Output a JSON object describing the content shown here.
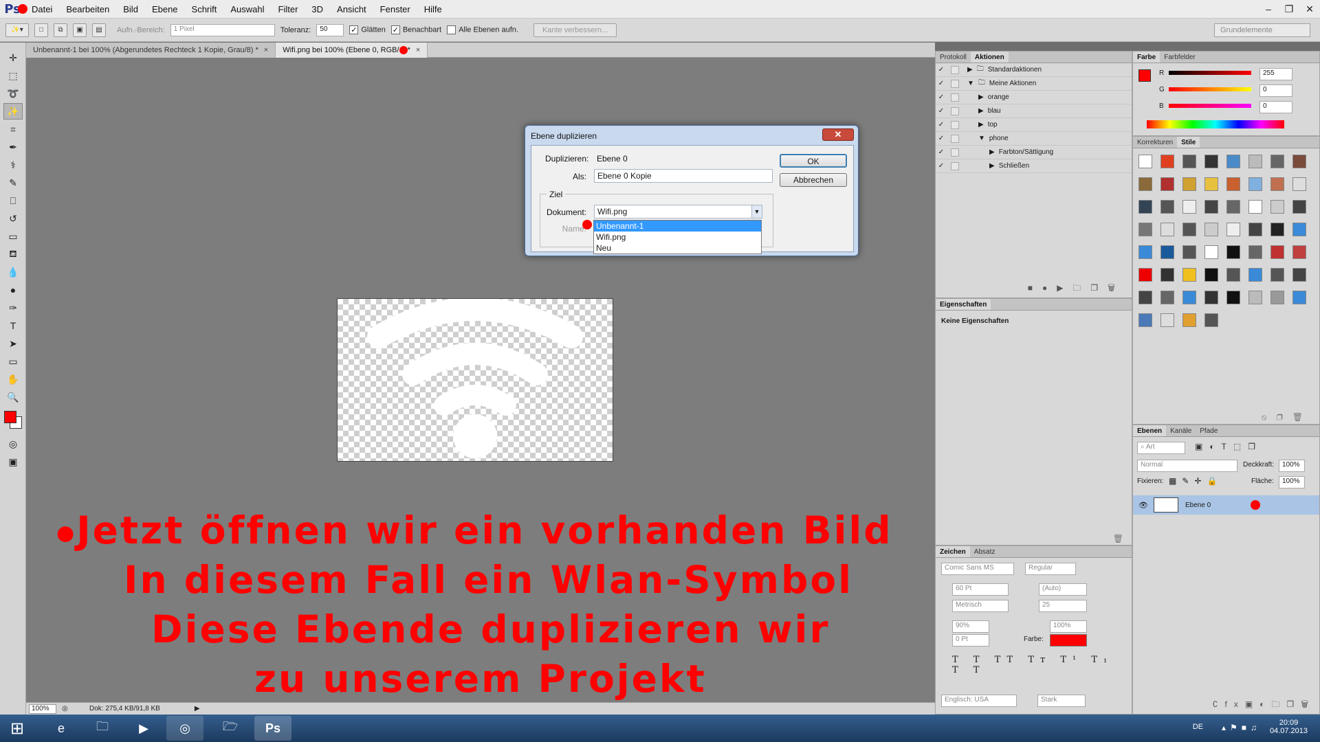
{
  "menubar": {
    "logo": "Ps",
    "items": [
      "Datei",
      "Bearbeiten",
      "Bild",
      "Ebene",
      "Schrift",
      "Auswahl",
      "Filter",
      "3D",
      "Ansicht",
      "Fenster",
      "Hilfe"
    ]
  },
  "options": {
    "aufn_label": "Aufn.-Bereich:",
    "aufn_value": "1 Pixel",
    "toleranz_label": "Toleranz:",
    "toleranz_value": "50",
    "glaetten": "Glätten",
    "benachbart": "Benachbart",
    "alle_ebenen": "Alle Ebenen aufn.",
    "kante": "Kante verbessern...",
    "workspace": "Grundelemente"
  },
  "tabs": [
    {
      "label": "Unbenannt-1 bei 100% (Abgerundetes Rechteck 1 Kopie, Grau/8) *"
    },
    {
      "label": "Wifi.png bei 100% (Ebene 0, RGB/"
    }
  ],
  "status": {
    "zoom": "100%",
    "doc": "Dok: 275,4 KB/91,8 KB"
  },
  "caption": {
    "line1": "Jetzt öffnen wir ein vorhanden Bild",
    "line2": "In diesem Fall ein Wlan-Symbol",
    "line3": "Diese Ebende duplizieren wir",
    "line4": "zu unserem Projekt"
  },
  "dialog": {
    "title": "Ebene duplizieren",
    "dup_label": "Duplizieren:",
    "dup_value": "Ebene 0",
    "als_label": "Als:",
    "als_value": "Ebene 0 Kopie",
    "ziel": "Ziel",
    "dokument_label": "Dokument:",
    "dokument_value": "Wifi.png",
    "name_label": "Name:",
    "ok": "OK",
    "cancel": "Abbrechen",
    "options": [
      "Unbenannt-1",
      "Wifi.png",
      "Neu"
    ]
  },
  "actions_panel": {
    "tabs": [
      "Protokoll",
      "Aktionen"
    ],
    "rows": [
      "Standardaktionen",
      "Meine Aktionen",
      "orange",
      "blau",
      "top",
      "phone",
      "Farbton/Sättigung",
      "Schließen"
    ]
  },
  "color_panel": {
    "tabs": [
      "Farbe",
      "Farbfelder"
    ],
    "r_label": "R",
    "g_label": "G",
    "b_label": "B",
    "r": "255",
    "g": "0",
    "b": "0",
    "fg_color": "#ff0000"
  },
  "styles_panel": {
    "tabs": [
      "Korrekturen",
      "Stile"
    ]
  },
  "properties_panel": {
    "tab": "Eigenschaften",
    "text": "Keine Eigenschaften"
  },
  "layers_panel": {
    "tabs": [
      "Ebenen",
      "Kanäle",
      "Pfade"
    ],
    "filter": "Art",
    "blend": "Normal",
    "opacity_label": "Deckkraft:",
    "opacity": "100%",
    "lock_label": "Fixieren:",
    "fill_label": "Fläche:",
    "fill": "100%",
    "layer_name": "Ebene 0"
  },
  "char_panel": {
    "tabs": [
      "Zeichen",
      "Absatz"
    ],
    "font": "Comic Sans MS",
    "style": "Regular",
    "size": "60 Pt",
    "leading": "(Auto)",
    "kerning": "Metrisch",
    "tracking": "25",
    "vscale": "90%",
    "hscale": "100%",
    "baseline": "0 Pt",
    "color_label": "Farbe:",
    "lang": "Englisch: USA",
    "aa": "Stark"
  },
  "taskbar": {
    "lang": "DE",
    "time": "20:09",
    "date": "04.07.2013"
  }
}
